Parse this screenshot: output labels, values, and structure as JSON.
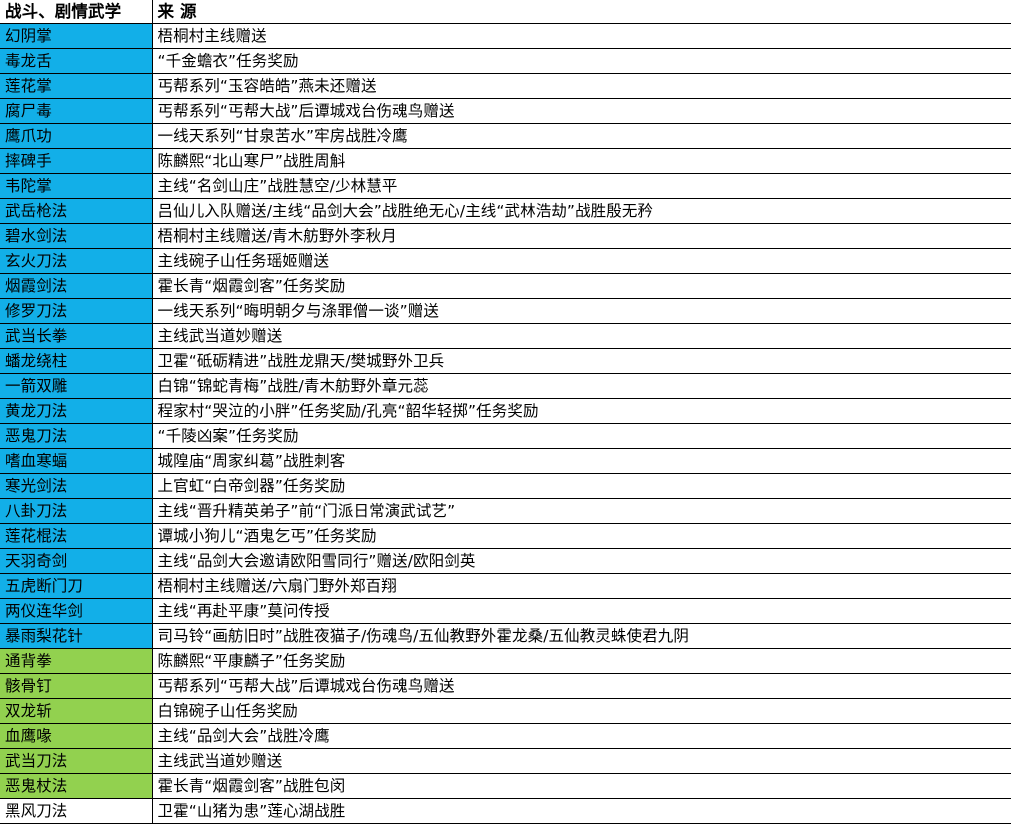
{
  "table": {
    "columns": [
      {
        "key": "name",
        "header": "战斗、剧情武学"
      },
      {
        "key": "source",
        "header": "来  源"
      }
    ],
    "fill_colors": {
      "blue": "#12AFE8",
      "green": "#92D14F",
      "none": "#FFFFFF"
    },
    "rows": [
      {
        "name": "幻阴掌",
        "source": "梧桐村主线赠送",
        "fill": "blue"
      },
      {
        "name": "毒龙舌",
        "source": "“千金蟾衣”任务奖励",
        "fill": "blue"
      },
      {
        "name": "莲花掌",
        "source": "丐帮系列“玉容皓皓”燕未还赠送",
        "fill": "blue"
      },
      {
        "name": "腐尸毒",
        "source": "丐帮系列“丐帮大战”后谭城戏台伤魂鸟赠送",
        "fill": "blue"
      },
      {
        "name": "鹰爪功",
        "source": "一线天系列“甘泉苦水”牢房战胜冷鹰",
        "fill": "blue"
      },
      {
        "name": "摔碑手",
        "source": "陈麟熙“北山寒尸”战胜周斛",
        "fill": "blue"
      },
      {
        "name": "韦陀掌",
        "source": "主线“名剑山庄”战胜慧空/少林慧平",
        "fill": "blue"
      },
      {
        "name": "武岳枪法",
        "source": "吕仙儿入队赠送/主线“品剑大会”战胜绝无心/主线“武林浩劫”战胜殷无矜",
        "fill": "blue"
      },
      {
        "name": "碧水剑法",
        "source": "梧桐村主线赠送/青木舫野外李秋月",
        "fill": "blue"
      },
      {
        "name": "玄火刀法",
        "source": "主线碗子山任务瑶姬赠送",
        "fill": "blue"
      },
      {
        "name": "烟霞剑法",
        "source": "霍长青“烟霞剑客”任务奖励",
        "fill": "blue"
      },
      {
        "name": "修罗刀法",
        "source": "一线天系列“晦明朝夕与涤罪僧一谈”赠送",
        "fill": "blue"
      },
      {
        "name": "武当长拳",
        "source": "主线武当道妙赠送",
        "fill": "blue"
      },
      {
        "name": "蟠龙绕柱",
        "source": "卫霍“砥砺精进”战胜龙鼎天/樊城野外卫兵",
        "fill": "blue"
      },
      {
        "name": "一箭双雕",
        "source": "白锦“锦蛇青梅”战胜/青木舫野外章元蕊",
        "fill": "blue"
      },
      {
        "name": "黄龙刀法",
        "source": "程家村“哭泣的小胖”任务奖励/孔亮“韶华轻掷”任务奖励",
        "fill": "blue"
      },
      {
        "name": "恶鬼刀法",
        "source": "“千陵凶案”任务奖励",
        "fill": "blue"
      },
      {
        "name": "嗜血寒蝠",
        "source": "城隍庙“周家纠葛”战胜刺客",
        "fill": "blue"
      },
      {
        "name": "寒光剑法",
        "source": "上官虹“白帝剑器”任务奖励",
        "fill": "blue"
      },
      {
        "name": "八卦刀法",
        "source": "主线“晋升精英弟子”前“门派日常演武试艺”",
        "fill": "blue"
      },
      {
        "name": "莲花棍法",
        "source": "谭城小狗儿“酒鬼乞丐”任务奖励",
        "fill": "blue"
      },
      {
        "name": "天羽奇剑",
        "source": "主线“品剑大会邀请欧阳雪同行”赠送/欧阳剑英",
        "fill": "blue"
      },
      {
        "name": "五虎断门刀",
        "source": "梧桐村主线赠送/六扇门野外郑百翔",
        "fill": "blue"
      },
      {
        "name": "两仪连华剑",
        "source": "主线“再赴平康”莫问传授",
        "fill": "blue"
      },
      {
        "name": "暴雨梨花针",
        "source": "司马铃“画舫旧时”战胜夜猫子/伤魂鸟/五仙教野外霍龙桑/五仙教灵蛛使君九阴",
        "fill": "blue"
      },
      {
        "name": "通背拳",
        "source": "陈麟熙“平康麟子”任务奖励",
        "fill": "green"
      },
      {
        "name": "骸骨钉",
        "source": "丐帮系列“丐帮大战”后谭城戏台伤魂鸟赠送",
        "fill": "green"
      },
      {
        "name": "双龙斩",
        "source": "白锦碗子山任务奖励",
        "fill": "green"
      },
      {
        "name": "血鹰喙",
        "source": "主线“品剑大会”战胜冷鹰",
        "fill": "green"
      },
      {
        "name": "武当刀法",
        "source": "主线武当道妙赠送",
        "fill": "green"
      },
      {
        "name": "恶鬼杖法",
        "source": "霍长青“烟霞剑客”战胜包闵",
        "fill": "green"
      },
      {
        "name": "黑风刀法",
        "source": "卫霍“山猪为患”莲心湖战胜",
        "fill": "none"
      }
    ]
  },
  "watermark": {
    "text": ""
  }
}
